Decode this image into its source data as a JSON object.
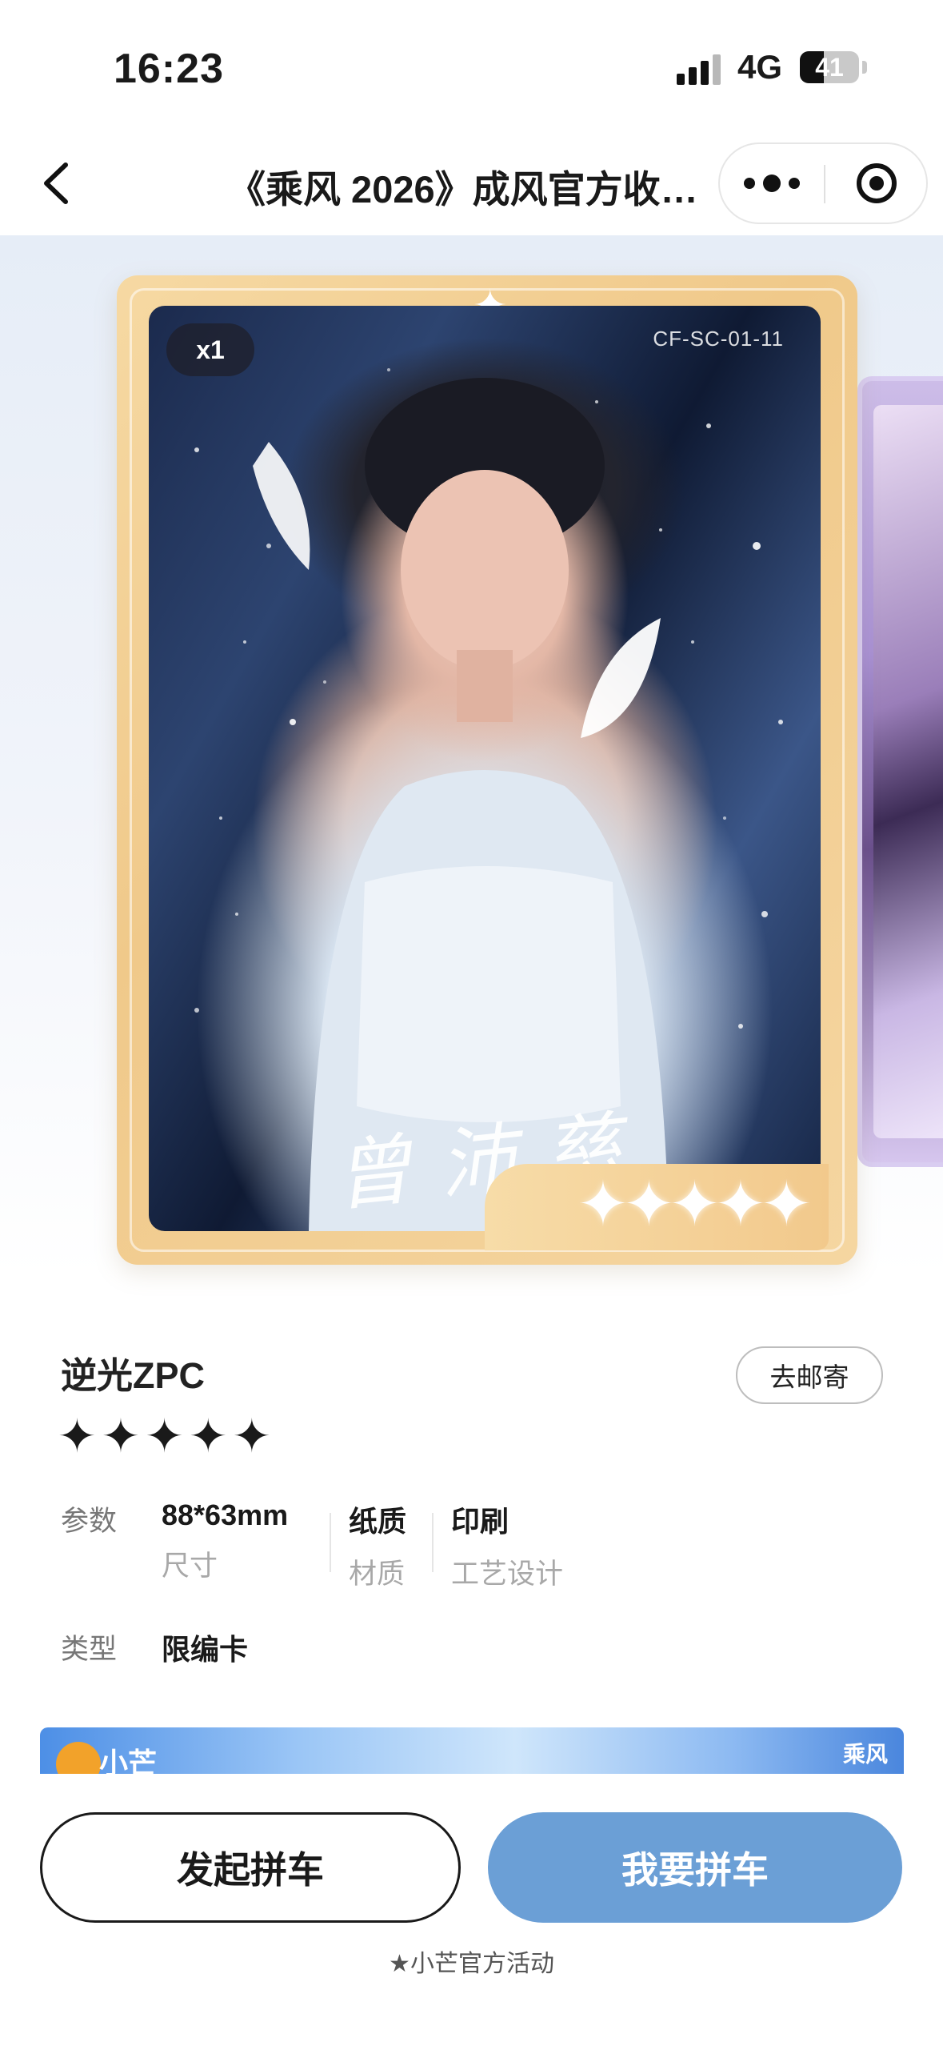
{
  "status_bar": {
    "time": "16:23",
    "network": "4G",
    "battery": 41
  },
  "nav": {
    "title": "《乘风 2026》成风官方收…"
  },
  "card": {
    "count": "x1",
    "serial": "CF-SC-01-11",
    "signature": "曾沛慈",
    "star_count": 5,
    "star_glyph": "✦"
  },
  "info": {
    "name": "逆光ZPC",
    "mail_button": "去邮寄",
    "rating": [
      "✦",
      "✦",
      "✦",
      "✦",
      "✦"
    ],
    "params_label": "参数",
    "params": [
      {
        "value": "88*63mm",
        "key": "尺寸"
      },
      {
        "value": "纸质",
        "key": "材质"
      },
      {
        "value": "印刷",
        "key": "工艺设计"
      }
    ],
    "type_label": "类型",
    "type_value": "限编卡",
    "banner": {
      "logo_text": "小芒",
      "brand": "乘风"
    }
  },
  "actions": {
    "start": "发起拼车",
    "join": "我要拼车",
    "footnote": "★小芒官方活动"
  },
  "colors": {
    "join_button": "#6b9fd6",
    "card_gold": "#f0c98a"
  }
}
